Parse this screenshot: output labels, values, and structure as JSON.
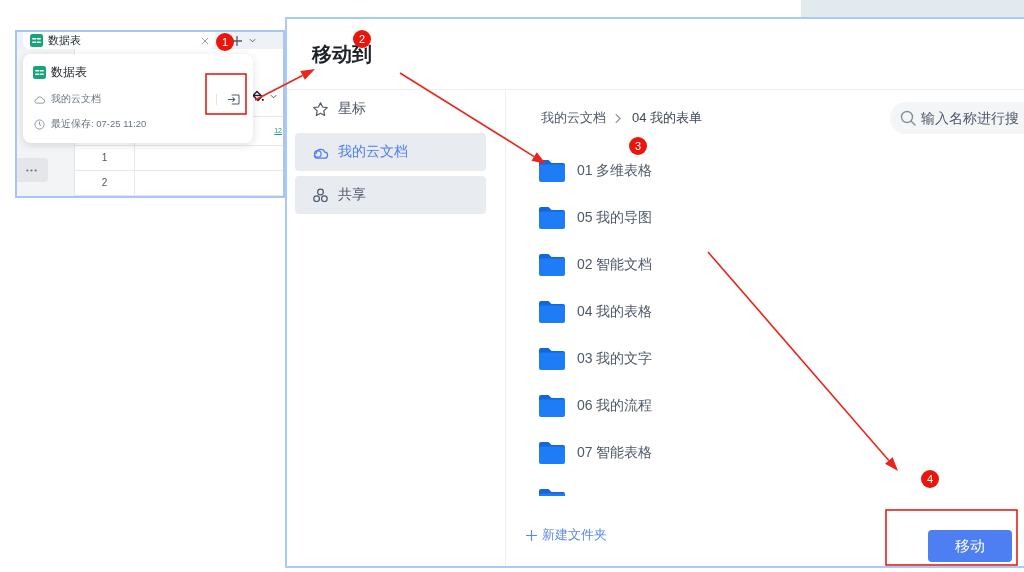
{
  "app_window": {
    "tab": {
      "title": "数据表"
    },
    "file_popup": {
      "title": "数据表",
      "location": "我的云文档",
      "last_saved": "最近保存: 07-25 11:20"
    },
    "sheet": {
      "column_label": "12",
      "row_numbers": [
        "1",
        "2"
      ]
    }
  },
  "dialog": {
    "title": "移动到",
    "sidebar": {
      "items": [
        {
          "kind": "star",
          "label": "星标",
          "selected": false,
          "hovered": false
        },
        {
          "kind": "cloud",
          "label": "我的云文档",
          "selected": true,
          "hovered": false
        },
        {
          "kind": "share",
          "label": "共享",
          "selected": false,
          "hovered": true
        }
      ]
    },
    "breadcrumb": [
      "我的云文档",
      "04 我的表单"
    ],
    "search": {
      "placeholder": "输入名称进行搜"
    },
    "folders": {
      "items": [
        "01 多维表格",
        "05 我的导图",
        "02 智能文档",
        "04 我的表格",
        "03 我的文字",
        "06 我的流程",
        "07 智能表格"
      ],
      "more_below": true
    },
    "new_folder_button": "新建文件夹",
    "move_button": "移动"
  },
  "annotations": {
    "markers": [
      "1",
      "2",
      "3",
      "4"
    ]
  }
}
